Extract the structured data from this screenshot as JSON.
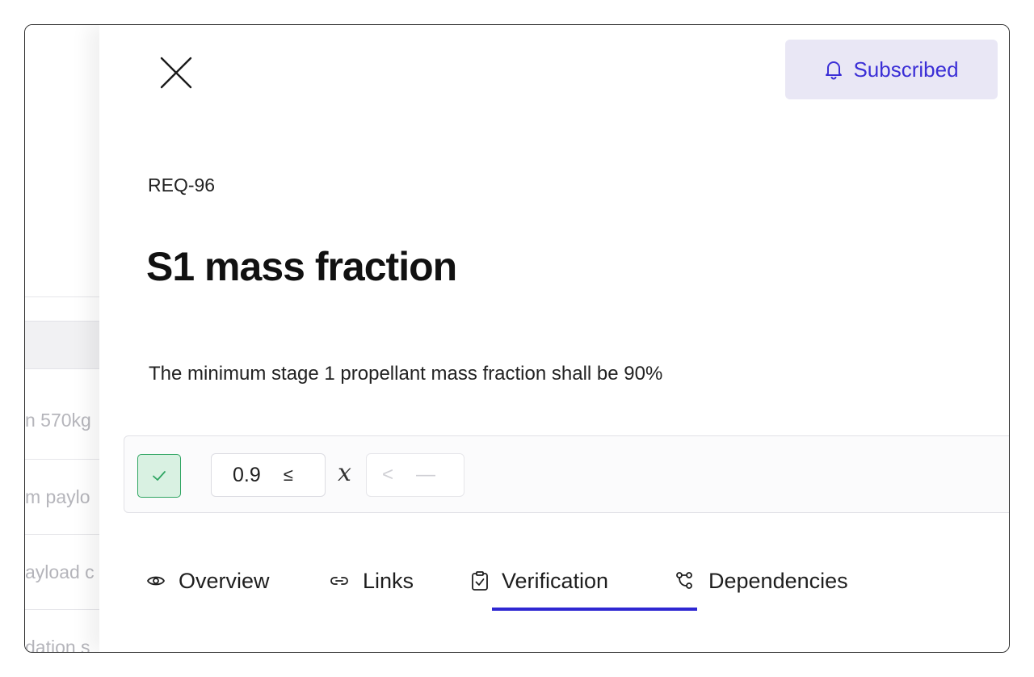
{
  "background_list": {
    "rows": [
      "n 570kg",
      "m paylo",
      "ayload c",
      "dation s"
    ]
  },
  "drawer": {
    "close_label": "Close",
    "subscribe_button": {
      "label": "Subscribed",
      "icon": "bell-icon",
      "color": "#3b2fd6",
      "background": "#e9e7f5"
    },
    "requirement_id": "REQ-96",
    "title": "S1 mass fraction",
    "description": "The minimum stage 1 propellant mass fraction shall be 90%",
    "constraint": {
      "status": "verified",
      "status_icon": "check-icon",
      "status_color": "#2fa562",
      "min_value": "0.9",
      "min_operator": "≤",
      "variable": "x",
      "max_operator": "<",
      "max_value": "—"
    },
    "tabs": [
      {
        "label": "Overview",
        "icon": "eye-icon"
      },
      {
        "label": "Links",
        "icon": "link-icon"
      },
      {
        "label": "Verification",
        "icon": "clipboard-check-icon",
        "active": true
      },
      {
        "label": "Dependencies",
        "icon": "dependencies-icon"
      }
    ],
    "active_tab": "Verification",
    "accent_color": "#2e27d2"
  }
}
